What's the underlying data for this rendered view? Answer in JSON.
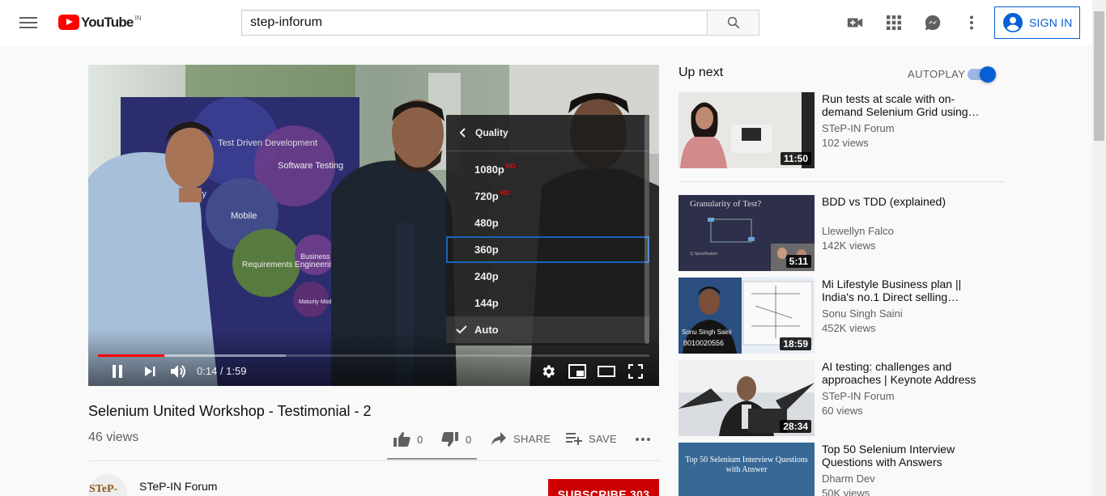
{
  "masthead": {
    "logo_text": "YouTube",
    "region": "IN",
    "search_value": "step-inforum",
    "sign_in_label": "SIGN IN"
  },
  "player": {
    "time_display": "0:14 / 1:59",
    "progress_played_fraction": 0.12,
    "progress_loaded_fraction": 0.34,
    "quality_menu": {
      "title": "Quality",
      "options": [
        {
          "label": "1080p",
          "badge": "HD"
        },
        {
          "label": "720p",
          "badge": "HD"
        },
        {
          "label": "480p",
          "badge": ""
        },
        {
          "label": "360p",
          "badge": ""
        },
        {
          "label": "240p",
          "badge": ""
        },
        {
          "label": "144p",
          "badge": ""
        },
        {
          "label": "Auto",
          "badge": ""
        }
      ],
      "selected": "Auto",
      "focused": "360p"
    },
    "video_text": {
      "bubble1": "Test Driven Development",
      "bubble2": "Software Testing",
      "bubble3": "Mobile",
      "bubble4": "Requirements Engineering",
      "bubble5": "Business Analysis",
      "bubble6": "Maturity Models",
      "bubble7": "ility"
    }
  },
  "video": {
    "title": "Selenium United Workshop - Testimonial - 2",
    "views": "46 views",
    "likes": "0",
    "dislikes": "0",
    "share_label": "SHARE",
    "save_label": "SAVE"
  },
  "owner": {
    "avatar_text": "STeP-IN",
    "channel_name": "STeP-IN Forum",
    "subscribe_label": "SUBSCRIBE",
    "subscriber_count": "303"
  },
  "sidebar": {
    "up_next_label": "Up next",
    "autoplay_label": "AUTOPLAY",
    "autoplay_on": true,
    "items": [
      {
        "title": "Run tests at scale with on-demand Selenium Grid using…",
        "channel": "STeP-IN Forum",
        "views": "102 views",
        "duration": "11:50"
      },
      {
        "title": "BDD vs TDD (explained)",
        "channel": "Llewellyn Falco",
        "views": "142K views",
        "duration": "5:11",
        "thumb_title": "Granularity of Test?",
        "thumb_caption": "1) Specification"
      },
      {
        "title": "Mi Lifestyle Business plan || India's no.1 Direct selling…",
        "channel": "Sonu Singh Saini",
        "views": "452K views",
        "duration": "18:59",
        "thumb_name": "Sonu Singh Saini",
        "thumb_phone": "8010020556"
      },
      {
        "title": "AI testing: challenges and approaches | Keynote Address",
        "channel": "STeP-IN Forum",
        "views": "60 views",
        "duration": "28:34"
      },
      {
        "title": "Top 50 Selenium Interview Questions with Answers",
        "channel": "Dharm Dev",
        "views": "50K views",
        "duration": "",
        "thumb_title": "Top 50 Selenium Interview Questions with Answer"
      }
    ]
  },
  "colors": {
    "brand_red": "#ff0000",
    "link_blue": "#065fd4",
    "subscribe_red": "#cc0000"
  }
}
